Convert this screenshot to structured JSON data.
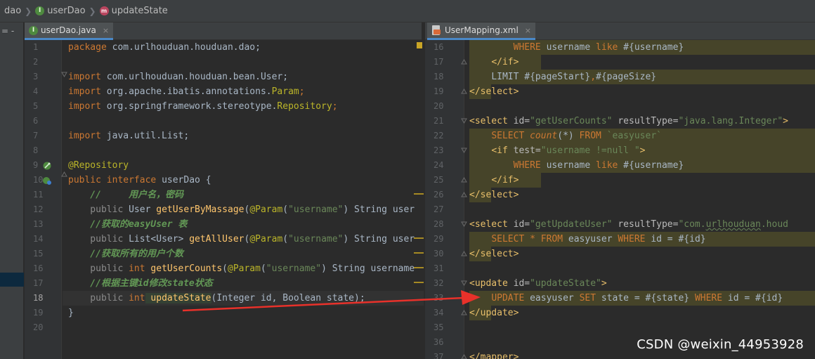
{
  "breadcrumb": {
    "segments": [
      "dao",
      "userDao",
      "updateState"
    ],
    "icons": {
      "userDao": "interface-i-icon",
      "updateState": "method-m-icon"
    }
  },
  "stripe": {
    "label": "= -"
  },
  "tabs": {
    "left": {
      "label": "userDao.java",
      "close": "×"
    },
    "right": {
      "label": "UserMapping.xml",
      "close": "×"
    }
  },
  "java_editor": {
    "line_numbers": [
      "1",
      "2",
      "3",
      "4",
      "5",
      "6",
      "7",
      "8",
      "9",
      "10",
      "11",
      "12",
      "13",
      "14",
      "15",
      "16",
      "17",
      "18",
      "19",
      "20"
    ],
    "current_line": "18",
    "text": {
      "kw_package": "package",
      "pkg": " com.urlhouduan.houduan.dao;",
      "kw_import": "import",
      "imp1": " com.urlhouduan.houduan.bean.User;",
      "imp2a": " org.apache.ibatis.annotations.",
      "imp2b": "Param",
      "imp2c": ";",
      "imp3a": " org.springframework.stereotype.",
      "imp3b": "Repository",
      "imp3c": ";",
      "imp4": " java.util.List;",
      "ann_repo": "@Repository",
      "kw_public": "public",
      "kw_interface": " interface",
      "iface_name": " userDao {",
      "c1": "    //     用户名，密码",
      "l12a": "    public",
      "l12b": " User ",
      "l12c": "getUserByMassage",
      "l12d": "(",
      "ann_param": "@Param",
      "paren_open": "(",
      "s_username": "\"username\"",
      "l12e": ") String user",
      "c2": "    //获取的easyUser 表",
      "l14a": "    public",
      "l14b": " List<User> ",
      "l14c": "getAllUser",
      "l14d": "(",
      "l14e": ") String user",
      "c3": "    //获取所有的用户个数",
      "l16a": "    public",
      "l16b": " int",
      "l16c": " getUserCounts",
      "l16d": "(",
      "l16e": ") String username",
      "c4": "    //根据主键id修改state状态",
      "l18a": "    public",
      "l18b": " int",
      "l18c": " updateState",
      "l18d": "(Integer id, Boolean state);",
      "close_brace": "}"
    }
  },
  "xml_editor": {
    "line_numbers": [
      "16",
      "17",
      "18",
      "19",
      "20",
      "21",
      "22",
      "23",
      "24",
      "25",
      "26",
      "27",
      "28",
      "29",
      "30",
      "31",
      "32",
      "33",
      "34",
      "35",
      "36",
      "37"
    ],
    "text": {
      "where": "WHERE",
      "username": " username ",
      "like": "like",
      "param_username": " #{username}",
      "endif": "</if>",
      "limit": "LIMIT #{pageStart}",
      "comma": ",",
      "pagesize": "#{pageSize}",
      "endselect": "</select>",
      "select_open": "<select",
      "attr_id": " id=",
      "v_getUserCounts": "\"getUserCounts\"",
      "attr_rt": " resultType=",
      "v_integer": "\"java.lang.Integer\"",
      "gt": ">",
      "kw_select": "SELECT",
      "fn_count": " count",
      "star_paren": "(*)",
      "kw_from": " FROM",
      "tbl_easyuser_bt": " `easyuser`",
      "if_open": "<if",
      "attr_test": " test=",
      "v_test": "\"username !=null \"",
      "v_getUpdateUser": "\"getUpdateUser\"",
      "v_rt2a": "\"com.",
      "v_rt2b": "urlhouduan",
      "v_rt2c": ".houd",
      "star": " *",
      "tbl_easyuser": " easyuser ",
      "cond_id": " id = #{id}",
      "update_open": "<update",
      "v_updateState": "\"updateState\"",
      "kw_update": "UPDATE",
      "kw_set": "SET",
      "set_state": " state = #{state} ",
      "cond_id2": " id = #{id}",
      "endupdate": "</update>",
      "endmapper": "</mapper>"
    }
  },
  "watermark": "CSDN @weixin_44953928",
  "colors": {
    "arrow": "#e8312a",
    "keyword": "#cc7832",
    "annotation": "#bbb529",
    "string": "#6a8759",
    "comment": "#629755",
    "xml_tag": "#e8bf6a",
    "sql_background": "#464429"
  }
}
